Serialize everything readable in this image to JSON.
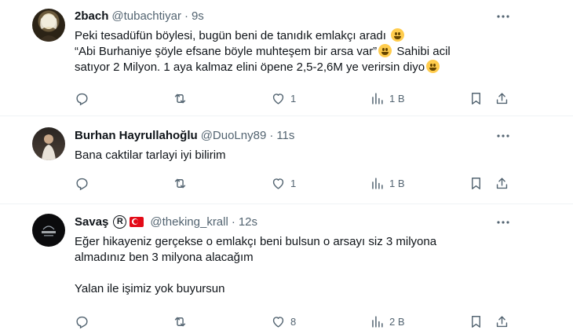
{
  "tweets": [
    {
      "name": "2bach",
      "handle": "@tubachtiyar",
      "dot": "·",
      "time": "9s",
      "lines": [
        "Peki tesadüfün böylesi, bugün beni de tanıdık emlakçı aradı",
        "“Abi Burhaniye şöyle efsane böyle muhteşem bir arsa var”",
        "Sahibi acil",
        "satıyor 2 Milyon. 1 aya kalmaz elini öpene 2,5-2,6M ye verirsin diyo"
      ],
      "likes": "1",
      "views": "1 B"
    },
    {
      "name": "Burhan Hayrullahoğlu",
      "handle": "@DuoLny89",
      "dot": "·",
      "time": "11s",
      "lines": [
        "Bana caktilar tarlayi iyi bilirim"
      ],
      "likes": "1",
      "views": "1 B"
    },
    {
      "name": "Savaş",
      "badge": "R",
      "handle": "@theking_krall",
      "dot": "·",
      "time": "12s",
      "lines": [
        "Eğer hikayeniz gerçekse o emlakçı beni bulsun o arsayı siz 3 milyona",
        "almadınız ben 3 milyona alacağım",
        "Yalan ile işimiz yok buyursun"
      ],
      "likes": "8",
      "views": "2 B"
    }
  ],
  "icons": {
    "more": "more-horizontal-icon",
    "reply": "reply-icon",
    "retweet": "retweet-icon",
    "like": "heart-icon",
    "views": "views-chart-icon",
    "bookmark": "bookmark-icon",
    "share": "share-icon"
  },
  "colors": {
    "text": "#0f1419",
    "secondary": "#536471",
    "divider": "#eff3f4"
  }
}
